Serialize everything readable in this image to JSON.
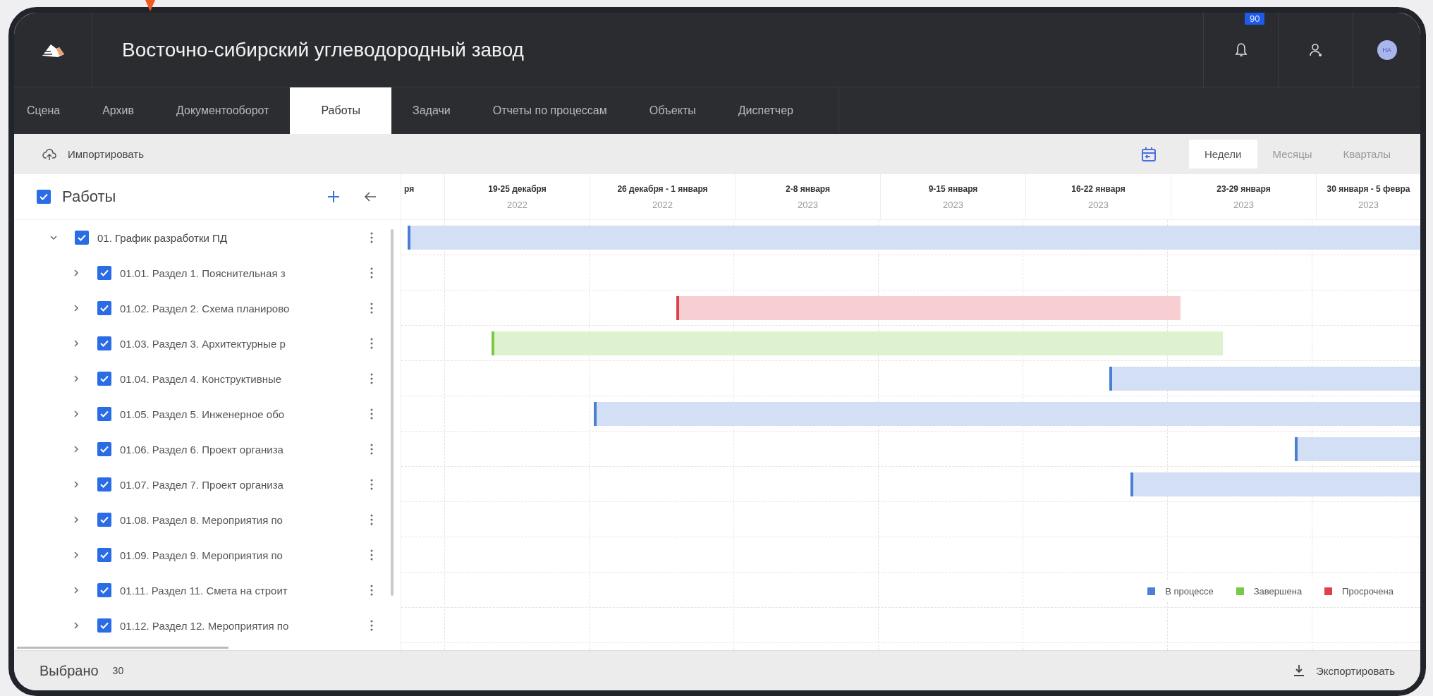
{
  "header": {
    "title": "Восточно-сибирский углеводородный завод",
    "notifications_badge": "90",
    "avatar": "НА"
  },
  "tabs": [
    {
      "label": "Сцена",
      "selected": false
    },
    {
      "label": "Архив",
      "selected": false
    },
    {
      "label": "Документооборот",
      "selected": false
    },
    {
      "label": "Работы",
      "selected": true
    },
    {
      "label": "Задачи",
      "selected": false
    },
    {
      "label": "Отчеты по процессам",
      "selected": false
    },
    {
      "label": "Объекты",
      "selected": false
    },
    {
      "label": "Диспетчер",
      "selected": false
    }
  ],
  "toolbar": {
    "import_label": "Импортировать",
    "views": [
      {
        "label": "Недели",
        "selected": true
      },
      {
        "label": "Месяцы",
        "selected": false
      },
      {
        "label": "Кварталы",
        "selected": false
      }
    ]
  },
  "tree": {
    "title": "Работы",
    "checked": true,
    "items": [
      {
        "label": "01. График разработки ПД",
        "checked": true,
        "expanded": true,
        "children": [
          {
            "label": "01.01. Раздел 1. Пояснительная з",
            "checked": true,
            "expanded": false
          },
          {
            "label": "01.02. Раздел 2. Схема планирово",
            "checked": true,
            "expanded": false
          },
          {
            "label": "01.03. Раздел 3. Архитектурные р",
            "checked": true,
            "expanded": false
          },
          {
            "label": "01.04. Раздел 4. Конструктивные",
            "checked": true,
            "expanded": false
          },
          {
            "label": "01.05. Раздел 5. Инженерное обо",
            "checked": true,
            "expanded": false
          },
          {
            "label": "01.06. Раздел 6. Проект организа",
            "checked": true,
            "expanded": false
          },
          {
            "label": "01.07. Раздел 7. Проект организа",
            "checked": true,
            "expanded": false
          },
          {
            "label": "01.08. Раздел 8. Мероприятия по",
            "checked": true,
            "expanded": false
          },
          {
            "label": "01.09. Раздел 9. Мероприятия по",
            "checked": true,
            "expanded": false
          },
          {
            "label": "01.11. Раздел 11. Смета на строит",
            "checked": true,
            "expanded": false
          },
          {
            "label": "01.12. Раздел 12. Мероприятия по",
            "checked": true,
            "expanded": false
          }
        ]
      }
    ]
  },
  "timeline": {
    "columns": [
      {
        "label": "ря"
      },
      {
        "label": "19-25 декабря",
        "year": "2022"
      },
      {
        "label": "26 декабря - 1 января",
        "year": "2022"
      },
      {
        "label": "2-8 января",
        "year": "2023"
      },
      {
        "label": "9-15 января",
        "year": "2023"
      },
      {
        "label": "16-22 января",
        "year": "2023"
      },
      {
        "label": "23-29 января",
        "year": "2023"
      },
      {
        "label": "30 января - 5 февра",
        "year": "2023"
      }
    ]
  },
  "gantt_rows": [
    {
      "bar": true,
      "color": "#4a7fd4"
    },
    {
      "bar": false
    },
    {
      "bar": true,
      "color": "#e0404e"
    },
    {
      "bar": true,
      "color": "#7ac943"
    },
    {
      "bar": true,
      "color": "#4a7fd4"
    },
    {
      "bar": true,
      "color": "#4a7fd4"
    },
    {
      "bar": true,
      "color": "#4a7fd4"
    },
    {
      "bar": true,
      "color": "#4a7fd4"
    },
    {
      "bar": false
    },
    {
      "bar": false
    },
    {
      "bar": false
    },
    {
      "bar": false
    }
  ],
  "legend": [
    {
      "label": "В процессе",
      "color": "#4a7fd4"
    },
    {
      "label": "Завершена",
      "color": "#7ac943"
    },
    {
      "label": "Просрочена",
      "color": "#e0404e"
    }
  ],
  "footer": {
    "selected_label": "Выбрано",
    "selected_count": "30",
    "export_label": "Экспортировать"
  }
}
